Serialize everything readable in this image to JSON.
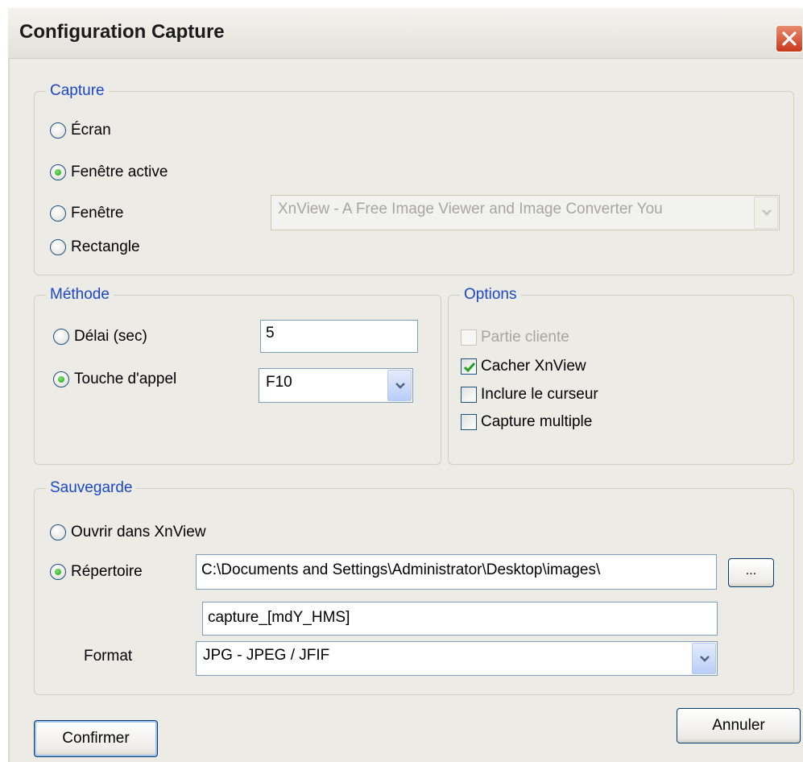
{
  "window": {
    "title": "Configuration Capture"
  },
  "capture": {
    "legend": "Capture",
    "options": [
      {
        "label": "Écran",
        "selected": false
      },
      {
        "label": "Fenêtre active",
        "selected": true
      },
      {
        "label": "Fenêtre",
        "selected": false
      },
      {
        "label": "Rectangle",
        "selected": false
      }
    ],
    "window_select": {
      "value": "XnView - A Free Image Viewer and Image Converter You",
      "enabled": false
    }
  },
  "method": {
    "legend": "Méthode",
    "delay": {
      "label": "Délai (sec)",
      "selected": false,
      "value": "5"
    },
    "hotkey": {
      "label": "Touche d'appel",
      "selected": true,
      "value": "F10"
    }
  },
  "options": {
    "legend": "Options",
    "items": [
      {
        "label": "Partie cliente",
        "checked": false,
        "enabled": false
      },
      {
        "label": "Cacher XnView",
        "checked": true,
        "enabled": true
      },
      {
        "label": "Inclure le curseur",
        "checked": false,
        "enabled": true
      },
      {
        "label": "Capture multiple",
        "checked": false,
        "enabled": true
      }
    ]
  },
  "save": {
    "legend": "Sauvegarde",
    "open_in_xnview": {
      "label": "Ouvrir dans XnView",
      "selected": false
    },
    "directory": {
      "label": "Répertoire",
      "selected": true,
      "path": "C:\\Documents and Settings\\Administrator\\Desktop\\images\\",
      "browse_label": "..."
    },
    "filename": "capture_[mdY_HMS]",
    "format": {
      "label": "Format",
      "value": "JPG - JPEG / JFIF"
    }
  },
  "buttons": {
    "confirm": "Confirmer",
    "cancel": "Annuler"
  },
  "colors": {
    "legend_text": "#1b47c8",
    "dialog_bg": "#ecebe6",
    "close_button": "#c8391b",
    "radio_dot": "#21a121",
    "check_mark": "#21a121"
  }
}
